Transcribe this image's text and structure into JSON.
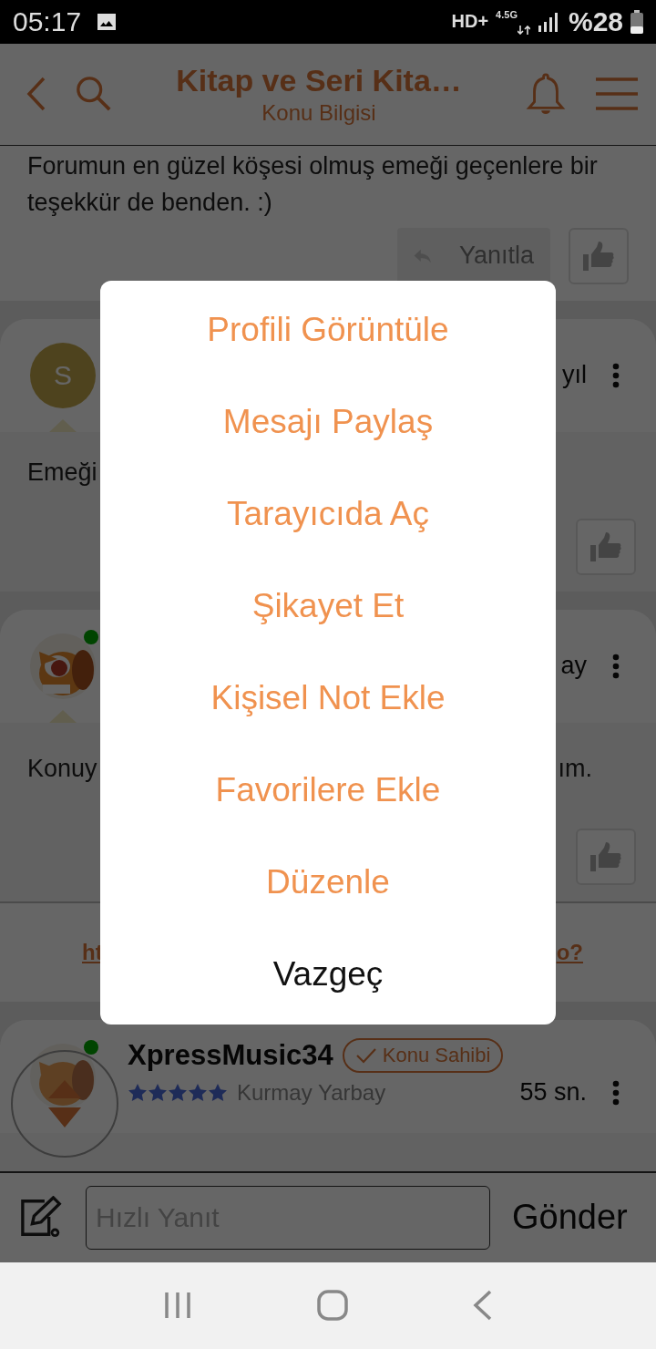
{
  "status_bar": {
    "time": "05:17",
    "network": "HD+",
    "network_type": "4.5G",
    "battery": "%28"
  },
  "header": {
    "title": "Kitap ve Seri Kita…",
    "subtitle": "Konu Bilgisi"
  },
  "previous_post": {
    "text": "Forumun en güzel köşesi olmuş emeği geçenlere bir teşekkür de benden. :)",
    "reply_button": "Yanıtla"
  },
  "posts": [
    {
      "avatar": {
        "kind": "letter",
        "letter": "S"
      },
      "online": false,
      "time": "yıl",
      "body_start": "Emeği"
    },
    {
      "online": true,
      "time": "ay",
      "body_start": "Konuy",
      "body_end": "ım."
    }
  ],
  "link": {
    "start": "ht",
    "end": "o?"
  },
  "last_post": {
    "online": true,
    "username": "XpressMusic34",
    "badge": "Konu Sahibi",
    "stars": 5,
    "rank": "Kurmay Yarbay",
    "time": "55 sn."
  },
  "reply_bar": {
    "placeholder": "Hızlı Yanıt",
    "send": "Gönder"
  },
  "dialog": {
    "items": [
      {
        "label": "Profili Görüntüle",
        "kind": "action"
      },
      {
        "label": "Mesajı Paylaş",
        "kind": "action"
      },
      {
        "label": "Tarayıcıda Aç",
        "kind": "action"
      },
      {
        "label": "Şikayet Et",
        "kind": "action"
      },
      {
        "label": "Kişisel Not Ekle",
        "kind": "action"
      },
      {
        "label": "Favorilere Ekle",
        "kind": "action"
      },
      {
        "label": "Düzenle",
        "kind": "action"
      },
      {
        "label": "Vazgeç",
        "kind": "cancel"
      }
    ]
  }
}
